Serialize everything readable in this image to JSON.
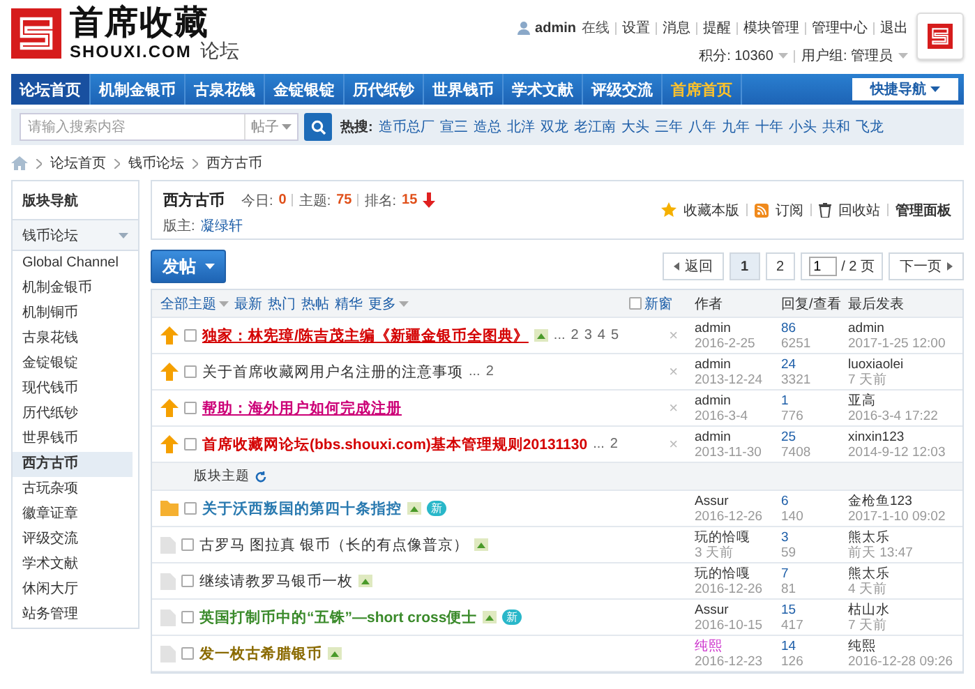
{
  "header": {
    "logo": {
      "name": "首席收藏",
      "domain": "SHOUXI.COM",
      "section": "论坛"
    },
    "user": {
      "name": "admin",
      "status": "在线",
      "links": [
        "设置",
        "消息",
        "提醒",
        "模块管理",
        "管理中心",
        "退出"
      ]
    },
    "stats": [
      {
        "label": "积分: 10360"
      },
      {
        "label": "用户组: 管理员"
      }
    ]
  },
  "nav": {
    "items": [
      {
        "label": "论坛首页",
        "selected": true,
        "highlight": false
      },
      {
        "label": "机制金银币",
        "selected": false,
        "highlight": false
      },
      {
        "label": "古泉花钱",
        "selected": false,
        "highlight": false
      },
      {
        "label": "金锭银锭",
        "selected": false,
        "highlight": false
      },
      {
        "label": "历代纸钞",
        "selected": false,
        "highlight": false
      },
      {
        "label": "世界钱币",
        "selected": false,
        "highlight": false
      },
      {
        "label": "学术文献",
        "selected": false,
        "highlight": false
      },
      {
        "label": "评级交流",
        "selected": false,
        "highlight": false
      },
      {
        "label": "首席首页",
        "selected": false,
        "highlight": true
      }
    ],
    "quick": "快捷导航"
  },
  "search": {
    "placeholder": "请输入搜索内容",
    "scope": "帖子",
    "hot_label": "热搜:",
    "hot": [
      "造币总厂",
      "宣三",
      "造总",
      "北洋",
      "双龙",
      "老江南",
      "大头",
      "三年",
      "八年",
      "九年",
      "十年",
      "小头",
      "共和",
      "飞龙"
    ]
  },
  "breadcrumb": [
    "论坛首页",
    "钱币论坛",
    "西方古币"
  ],
  "sidebar": {
    "title": "版块导航",
    "group": {
      "label": "钱币论坛",
      "expanded": true
    },
    "items": [
      {
        "label": "Global Channel",
        "selected": false
      },
      {
        "label": "机制金银币",
        "selected": false
      },
      {
        "label": "机制铜币",
        "selected": false
      },
      {
        "label": "古泉花钱",
        "selected": false
      },
      {
        "label": "金锭银锭",
        "selected": false
      },
      {
        "label": "现代钱币",
        "selected": false
      },
      {
        "label": "历代纸钞",
        "selected": false
      },
      {
        "label": "世界钱币",
        "selected": false
      },
      {
        "label": "西方古币",
        "selected": true
      },
      {
        "label": "古玩杂项",
        "selected": false
      },
      {
        "label": "徽章证章",
        "selected": false
      },
      {
        "label": "评级交流",
        "selected": false
      },
      {
        "label": "学术文献",
        "selected": false
      },
      {
        "label": "休闲大厅",
        "selected": false
      },
      {
        "label": "站务管理",
        "selected": false
      }
    ]
  },
  "forum": {
    "title": "西方古币",
    "stats": [
      {
        "label": "今日:",
        "value": "0"
      },
      {
        "label": "主题:",
        "value": "75"
      },
      {
        "label": "排名:",
        "value": "15"
      }
    ],
    "moderator_label": "版主:",
    "moderator": "凝绿轩",
    "actions": [
      {
        "kind": "star",
        "label": "收藏本版"
      },
      {
        "kind": "rss",
        "label": "订阅"
      },
      {
        "kind": "trash",
        "label": "回收站"
      },
      {
        "kind": "plain",
        "label": "管理面板"
      }
    ]
  },
  "post_button": "发帖",
  "pagination": {
    "back": "返回",
    "pages": [
      {
        "label": "1",
        "selected": true
      },
      {
        "label": "2",
        "selected": false
      }
    ],
    "input": "1",
    "total": "/ 2 页",
    "next": "下一页"
  },
  "filters": [
    {
      "label": "全部主题",
      "dropdown": true
    },
    {
      "label": "最新",
      "dropdown": false
    },
    {
      "label": "热门",
      "dropdown": false
    },
    {
      "label": "热帖",
      "dropdown": false
    },
    {
      "label": "精华",
      "dropdown": false
    },
    {
      "label": "更多",
      "dropdown": true
    }
  ],
  "new_window": {
    "label": "新窗",
    "checked": false
  },
  "columns": [
    "作者",
    "回复/查看",
    "最后发表"
  ],
  "sticky_threads": [
    {
      "kind": "pinned",
      "checked": false,
      "title": "独家：林宪璋/陈吉茂主编《新疆金银币全图典》",
      "color": "#d40000",
      "bold": true,
      "underline": true,
      "attachment": true,
      "pages": {
        "ellipsis": "...",
        "links": [
          "2",
          "3",
          "4",
          "5"
        ]
      },
      "close": "×",
      "author": {
        "name": "admin",
        "color": "#333333"
      },
      "date": "2016-2-25",
      "replies": "86",
      "views": "6251",
      "last_poster": "admin",
      "last_time": "2017-1-25 12:00"
    },
    {
      "kind": "pinned",
      "checked": false,
      "title": "关于首席收藏网用户名注册的注意事项",
      "color": "#333333",
      "bold": false,
      "underline": false,
      "attachment": false,
      "pages": {
        "ellipsis": "...",
        "links": [
          "2"
        ]
      },
      "close": "×",
      "author": {
        "name": "admin",
        "color": "#333333"
      },
      "date": "2013-12-24",
      "replies": "24",
      "views": "3321",
      "last_poster": "luoxiaolei",
      "last_time": "7 天前"
    },
    {
      "kind": "pinned",
      "checked": false,
      "title": "帮助：海外用户如何完成注册",
      "color": "#cc0077",
      "bold": true,
      "underline": true,
      "attachment": false,
      "close": "×",
      "author": {
        "name": "admin",
        "color": "#333333"
      },
      "date": "2016-3-4",
      "replies": "1",
      "views": "776",
      "last_poster": "亚高",
      "last_time": "2016-3-4 17:22"
    },
    {
      "kind": "pinned",
      "checked": false,
      "title": "首席收藏网论坛(bbs.shouxi.com)基本管理规则20131130",
      "color": "#d40000",
      "bold": true,
      "underline": false,
      "attachment": false,
      "pages": {
        "ellipsis": "...",
        "links": [
          "2"
        ]
      },
      "close": "×",
      "author": {
        "name": "admin",
        "color": "#333333"
      },
      "date": "2013-11-30",
      "replies": "25",
      "views": "7408",
      "last_poster": "xinxin123",
      "last_time": "2014-9-12 12:03"
    }
  ],
  "separator": "版块主题",
  "threads": [
    {
      "kind": "hot",
      "checked": false,
      "title": "关于沃西叛国的第四十条指控",
      "color": "#2a7ab0",
      "bold": true,
      "underline": false,
      "attachment": true,
      "badge": "新",
      "author": {
        "name": "Assur",
        "color": "#333333"
      },
      "date": "2016-12-26",
      "replies": "6",
      "views": "140",
      "last_poster": "金枪鱼123",
      "last_time": "2017-1-10 09:02"
    },
    {
      "kind": "normal",
      "checked": false,
      "title": "古罗马 图拉真 银币（长的有点像普京）",
      "color": "#333333",
      "bold": false,
      "underline": false,
      "attachment": true,
      "author": {
        "name": "玩的恰嘎",
        "color": "#333333"
      },
      "date": "3 天前",
      "replies": "3",
      "views": "59",
      "last_poster": "熊太乐",
      "last_time": "前天 13:47"
    },
    {
      "kind": "normal",
      "checked": false,
      "title": "继续请教罗马银币一枚",
      "color": "#333333",
      "bold": false,
      "underline": false,
      "attachment": true,
      "author": {
        "name": "玩的恰嘎",
        "color": "#333333"
      },
      "date": "2016-12-26",
      "replies": "7",
      "views": "81",
      "last_poster": "熊太乐",
      "last_time": "4 天前"
    },
    {
      "kind": "normal",
      "checked": false,
      "title": "英国打制币中的“五铢”—short cross便士",
      "color": "#3a8a2a",
      "bold": true,
      "underline": false,
      "attachment": true,
      "badge": "新",
      "author": {
        "name": "Assur",
        "color": "#333333"
      },
      "date": "2016-10-15",
      "replies": "15",
      "views": "417",
      "last_poster": "枯山水",
      "last_time": "7 天前"
    },
    {
      "kind": "normal",
      "checked": false,
      "title": "发一枚古希腊银币",
      "color": "#8a6a00",
      "bold": true,
      "underline": false,
      "attachment": true,
      "author": {
        "name": "纯熙",
        "color": "#cc33cc"
      },
      "date": "2016-12-23",
      "replies": "14",
      "views": "126",
      "last_poster": "纯熙",
      "last_time": "2016-12-28 09:26"
    }
  ]
}
